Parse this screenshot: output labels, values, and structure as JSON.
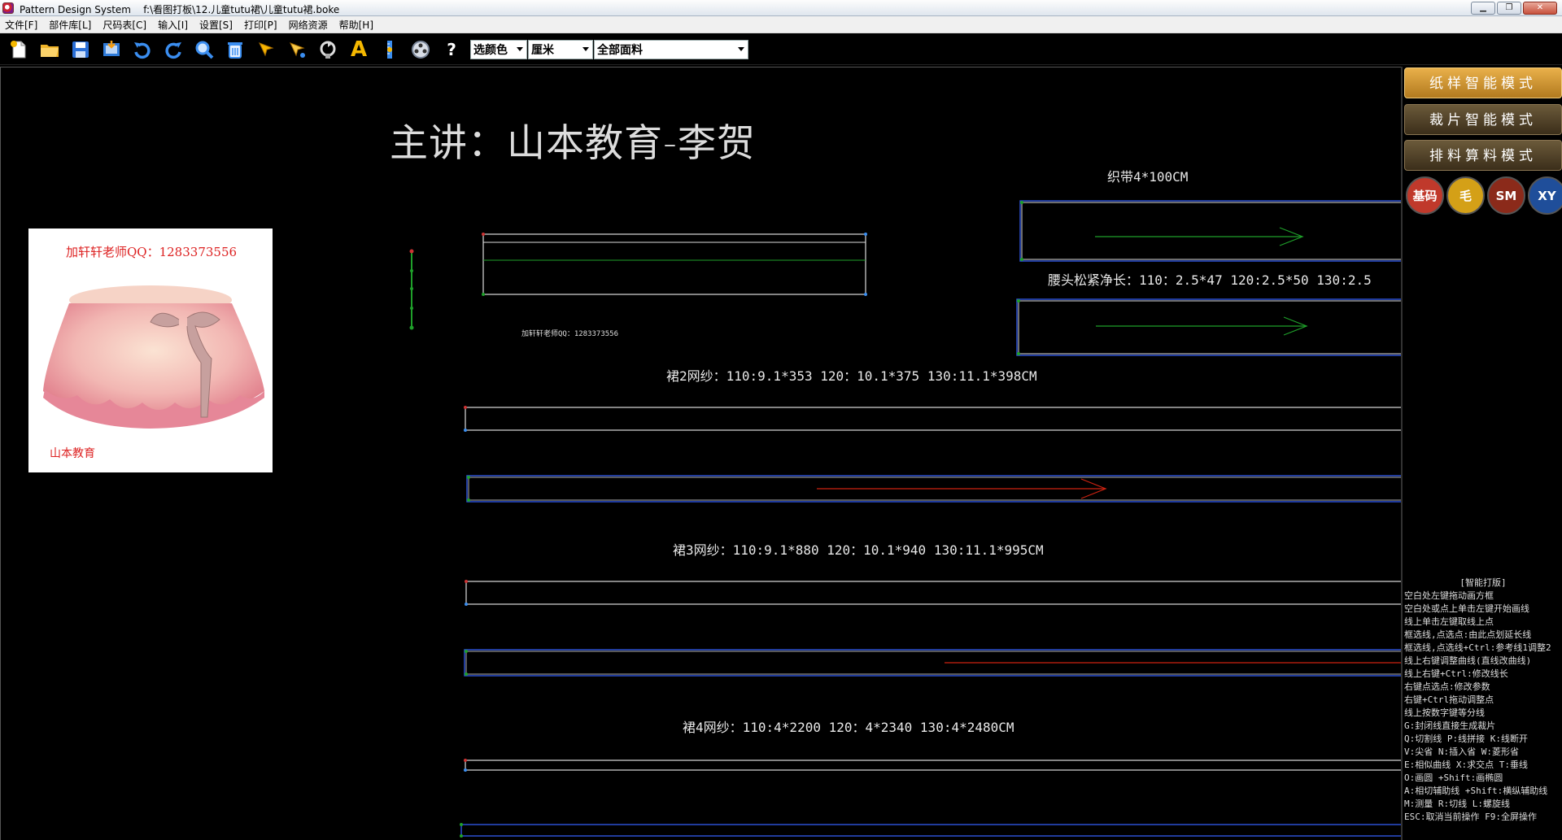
{
  "window": {
    "app_name": "Pattern Design System",
    "file_path": "f:\\看图打板\\12.儿童tutu裙\\儿童tutu裙.boke",
    "minimize_icon": "minimize-icon",
    "maximize_icon": "restore-icon",
    "close_icon": "close-icon"
  },
  "menu": [
    {
      "label": "文件[F]"
    },
    {
      "label": "部件库[L]"
    },
    {
      "label": "尺码表[C]"
    },
    {
      "label": "输入[I]"
    },
    {
      "label": "设置[S]"
    },
    {
      "label": "打印[P]"
    },
    {
      "label": "网络资源"
    },
    {
      "label": "帮助[H]"
    }
  ],
  "toolbar": {
    "icons": [
      "new-file-icon",
      "open-folder-icon",
      "save-icon",
      "import-icon",
      "undo-icon",
      "redo-icon",
      "zoom-icon",
      "delete-icon",
      "select-arrow-icon",
      "pick-arrow-icon",
      "rotate-icon",
      "text-tool-icon",
      "ruler-icon",
      "reel-icon",
      "help-icon"
    ],
    "help_label": "?",
    "text_tool_label": "A",
    "color_select": "选颜色",
    "unit_select": "厘米",
    "fabric_select": "全部面料"
  },
  "canvas": {
    "lecturer": "主讲：山本教育-李贺",
    "photo_card": {
      "qq": "加轩轩老师QQ：1283373556",
      "brand": "山本教育"
    },
    "tiny_note": "加轩轩老师QQ：1283373556",
    "labels": {
      "strap": "织带4*100CM",
      "waist": "腰头松紧净长：110：2.5*47  120:2.5*50  130:2.5",
      "skirt2": "裙2网纱：110:9.1*353  120：10.1*375 130:11.1*398CM",
      "skirt3": "裙3网纱：110:9.1*880  120：10.1*940 130:11.1*995CM",
      "skirt4": "裙4网纱：110:4*2200  120：4*2340 130:4*2480CM"
    }
  },
  "right_panel": {
    "modes": [
      {
        "label": "纸样智能模式",
        "active": true
      },
      {
        "label": "裁片智能模式",
        "active": false
      },
      {
        "label": "排料算料模式",
        "active": false
      }
    ],
    "round_buttons": [
      {
        "label": "基码",
        "color": "#c0392b"
      },
      {
        "label": "毛",
        "color": "#d4a017"
      },
      {
        "label": "SM",
        "color": "#8b2a1a"
      },
      {
        "label": "XY",
        "color": "#1f4e9a"
      }
    ],
    "help_title": "[智能打版]",
    "help_lines": [
      "空白处左键拖动画方框",
      "空白处或点上单击左键开始画线",
      "线上单击左键取线上点",
      "框选线,点选点:由此点划延长线",
      "框选线,点选线+Ctrl:参考线1调整2",
      "线上右键调整曲线(直线改曲线)",
      "线上右键+Ctrl:修改线长",
      "右键点选点:修改参数",
      "右键+Ctrl拖动调整点",
      "线上按数字键等分线",
      "G:封闭线直接生成裁片",
      "Q:切割线  P:线拼接  K:线断开",
      "V:尖省  N:插入省  W:菱形省",
      "E:相似曲线  X:求交点  T:垂线",
      "O:画圆 +Shift:画椭圆",
      "A:相切辅助线 +Shift:横纵辅助线",
      "M:测量  R:切线  L:螺旋线",
      "ESC:取消当前操作  F9:全屏操作"
    ]
  }
}
